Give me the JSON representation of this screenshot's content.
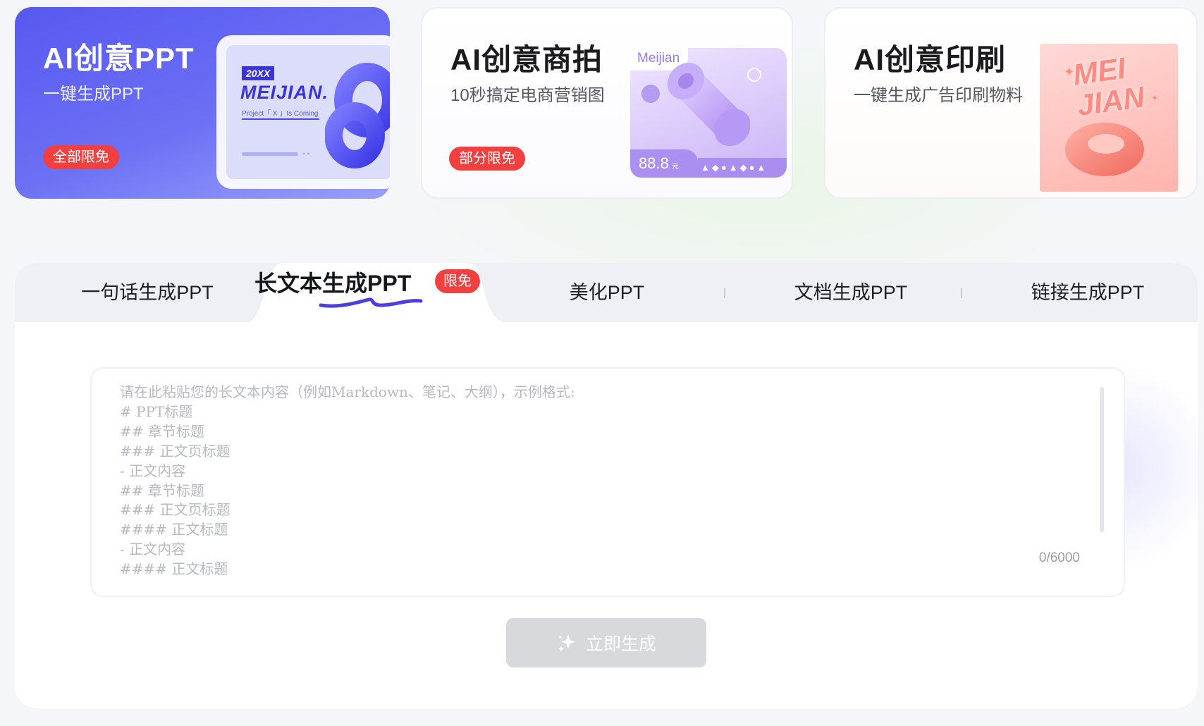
{
  "cards": [
    {
      "id": "ppt",
      "title_ai": "AI",
      "title_rest": "创意PPT",
      "subtitle": "一键生成PPT",
      "badge": "全部限免",
      "art": {
        "year": "20XX",
        "brand": "MEIJIAN.",
        "tagline": "Project「 X 」Is Coming"
      }
    },
    {
      "id": "photo",
      "title_ai": "AI",
      "title_rest": "创意商拍",
      "subtitle": "10秒搞定电商营销图",
      "badge": "部分限免",
      "art": {
        "brand": "Meijian",
        "price": "88.8",
        "price_unit": "元",
        "shapes": "▲◆●▲◆●▲"
      }
    },
    {
      "id": "print",
      "title_ai": "AI",
      "title_rest": "创意印刷",
      "subtitle": "一键生成广告印刷物料",
      "art": {
        "word_line1": "MEI",
        "word_line2": "JIAN"
      }
    }
  ],
  "tabs": [
    {
      "label": "一句话生成PPT",
      "active": false
    },
    {
      "label": "长文本生成PPT",
      "active": true,
      "badge": "限免"
    },
    {
      "label": "美化PPT",
      "active": false
    },
    {
      "label": "文档生成PPT",
      "active": false
    },
    {
      "label": "链接生成PPT",
      "active": false
    }
  ],
  "editor": {
    "placeholder": "请在此粘贴您的长文本内容（例如Markdown、笔记、大纲），示例格式:\n# PPT标题\n## 章节标题\n### 正文页标题\n- 正文内容\n## 章节标题\n### 正文页标题\n#### 正文标题\n- 正文内容\n#### 正文标题",
    "value": "",
    "counter": "0/6000"
  },
  "generate_button": {
    "label": "立即生成"
  },
  "colors": {
    "accent": "#5759f0",
    "badge_red": "#f23f3f",
    "button_disabled": "#d8d9dd",
    "placeholder_text": "#b7b9c0"
  },
  "icons": {
    "sparkle": "sparkle-icon",
    "knot": "3d-knot",
    "cylinder": "3d-cylinder",
    "ring": "3d-ring"
  }
}
